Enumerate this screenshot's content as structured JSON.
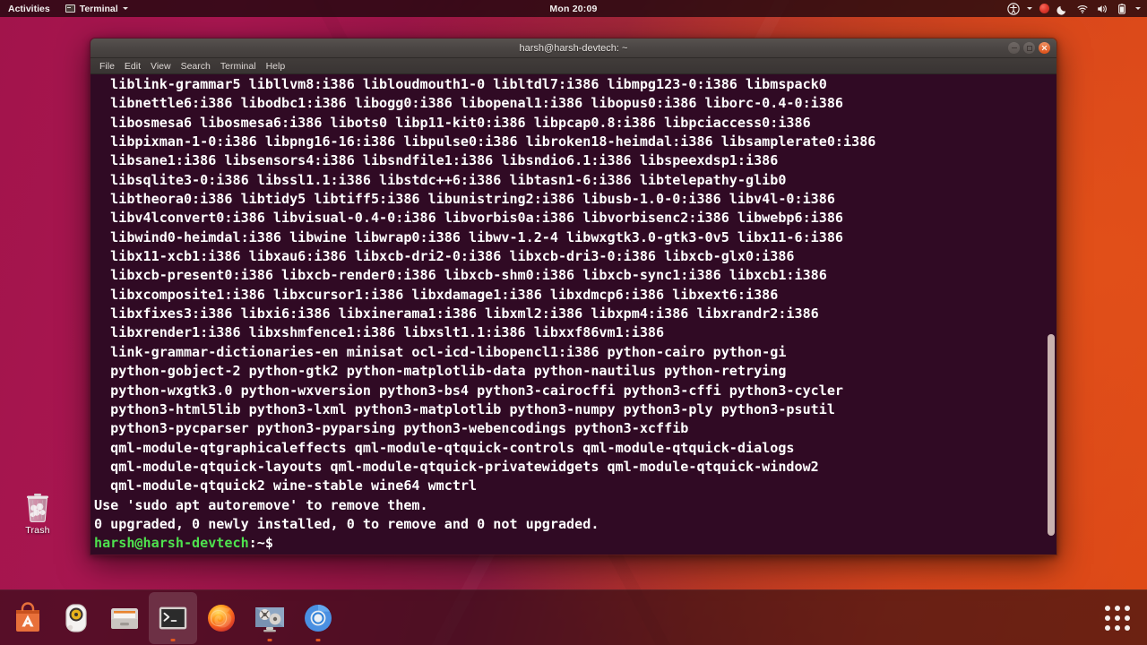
{
  "topbar": {
    "activities_label": "Activities",
    "app_menu_label": "Terminal",
    "app_menu_icon": "terminal-icon",
    "clock": "Mon 20:09",
    "tray": [
      {
        "name": "accessibility-icon",
        "label": "Accessibility"
      },
      {
        "name": "tray-dropdown-caret-icon",
        "label": ""
      },
      {
        "name": "recording-indicator-icon",
        "label": ""
      },
      {
        "name": "night-light-moon-icon",
        "label": ""
      },
      {
        "name": "wifi-icon",
        "label": ""
      },
      {
        "name": "volume-icon",
        "label": ""
      },
      {
        "name": "battery-icon",
        "label": ""
      },
      {
        "name": "system-menu-caret-icon",
        "label": ""
      }
    ]
  },
  "desktop": {
    "trash": {
      "label": "Trash",
      "icon": "trash-icon"
    },
    "wallpaper_colors": {
      "left": "#a2144b",
      "right": "#dd4814"
    }
  },
  "terminal": {
    "title": "harsh@harsh-devtech: ~",
    "menus": [
      "File",
      "Edit",
      "View",
      "Search",
      "Terminal",
      "Help"
    ],
    "window_buttons": [
      "minimize",
      "maximize",
      "close"
    ],
    "background_color": "#300a24",
    "foreground_color": "#ffffff",
    "prompt_color": "#4ee24e",
    "lines": [
      "  liblink-grammar5 libllvm8:i386 libloudmouth1-0 libltdl7:i386 libmpg123-0:i386 libmspack0",
      "  libnettle6:i386 libodbc1:i386 libogg0:i386 libopenal1:i386 libopus0:i386 liborc-0.4-0:i386",
      "  libosmesa6 libosmesa6:i386 libots0 libp11-kit0:i386 libpcap0.8:i386 libpciaccess0:i386",
      "  libpixman-1-0:i386 libpng16-16:i386 libpulse0:i386 libroken18-heimdal:i386 libsamplerate0:i386",
      "  libsane1:i386 libsensors4:i386 libsndfile1:i386 libsndio6.1:i386 libspeexdsp1:i386",
      "  libsqlite3-0:i386 libssl1.1:i386 libstdc++6:i386 libtasn1-6:i386 libtelepathy-glib0",
      "  libtheora0:i386 libtidy5 libtiff5:i386 libunistring2:i386 libusb-1.0-0:i386 libv4l-0:i386",
      "  libv4lconvert0:i386 libvisual-0.4-0:i386 libvorbis0a:i386 libvorbisenc2:i386 libwebp6:i386",
      "  libwind0-heimdal:i386 libwine libwrap0:i386 libwv-1.2-4 libwxgtk3.0-gtk3-0v5 libx11-6:i386",
      "  libx11-xcb1:i386 libxau6:i386 libxcb-dri2-0:i386 libxcb-dri3-0:i386 libxcb-glx0:i386",
      "  libxcb-present0:i386 libxcb-render0:i386 libxcb-shm0:i386 libxcb-sync1:i386 libxcb1:i386",
      "  libxcomposite1:i386 libxcursor1:i386 libxdamage1:i386 libxdmcp6:i386 libxext6:i386",
      "  libxfixes3:i386 libxi6:i386 libxinerama1:i386 libxml2:i386 libxpm4:i386 libxrandr2:i386",
      "  libxrender1:i386 libxshmfence1:i386 libxslt1.1:i386 libxxf86vm1:i386",
      "  link-grammar-dictionaries-en minisat ocl-icd-libopencl1:i386 python-cairo python-gi",
      "  python-gobject-2 python-gtk2 python-matplotlib-data python-nautilus python-retrying",
      "  python-wxgtk3.0 python-wxversion python3-bs4 python3-cairocffi python3-cffi python3-cycler",
      "  python3-html5lib python3-lxml python3-matplotlib python3-numpy python3-ply python3-psutil",
      "  python3-pycparser python3-pyparsing python3-webencodings python3-xcffib",
      "  qml-module-qtgraphicaleffects qml-module-qtquick-controls qml-module-qtquick-dialogs",
      "  qml-module-qtquick-layouts qml-module-qtquick-privatewidgets qml-module-qtquick-window2",
      "  qml-module-qtquick2 wine-stable wine64 wmctrl",
      "Use 'sudo apt autoremove' to remove them.",
      "0 upgraded, 0 newly installed, 0 to remove and 0 not upgraded."
    ],
    "prompt": {
      "user_host": "harsh@harsh-devtech",
      "separator": ":~$ "
    }
  },
  "dock": {
    "items": [
      {
        "name": "ubuntu-software-icon",
        "label": "Ubuntu Software",
        "running": false
      },
      {
        "name": "rhythmbox-icon",
        "label": "Rhythmbox",
        "running": false
      },
      {
        "name": "files-nautilus-icon",
        "label": "Files",
        "running": false
      },
      {
        "name": "terminal-icon",
        "label": "Terminal",
        "running": true,
        "active": true
      },
      {
        "name": "firefox-icon",
        "label": "Firefox",
        "running": false
      },
      {
        "name": "media-player-icon",
        "label": "Media Player",
        "running": true
      },
      {
        "name": "chromium-icon",
        "label": "Chromium",
        "running": true
      }
    ],
    "show_applications_label": "Show Applications"
  }
}
